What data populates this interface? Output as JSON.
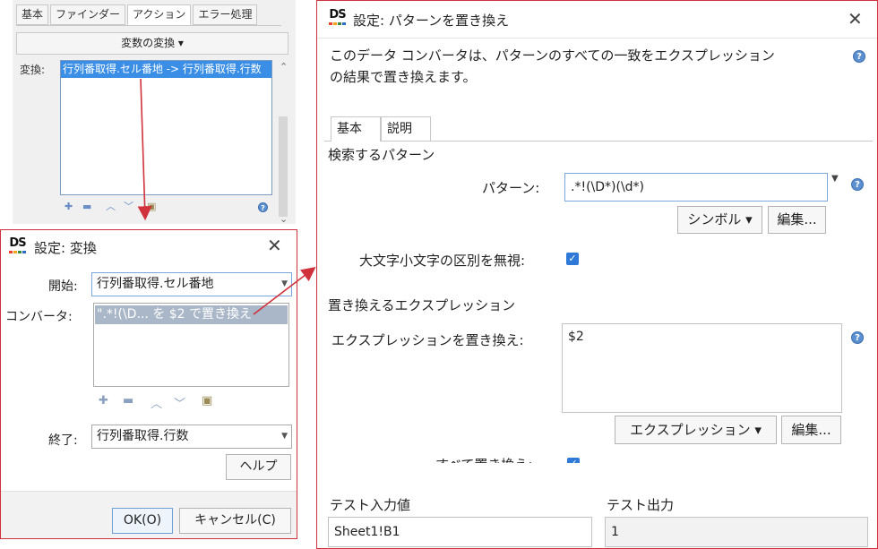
{
  "bg_panel": {
    "tabs": [
      "基本",
      "ファインダー",
      "アクション",
      "エラー処理"
    ],
    "active_tab": 2,
    "convert_menu": "変数の変換 ▾",
    "convert_label": "変換:",
    "convert_item": "行列番取得.セル番地 -> 行列番取得.行数"
  },
  "dialog1": {
    "title": "設定: 変換",
    "start_label": "開始:",
    "start_value": "行列番取得.セル番地",
    "converter_label": "コンバータ:",
    "converter_item": "\".*!(\\D... を $2 で置き換え",
    "end_label": "終了:",
    "end_value": "行列番取得.行数",
    "help_button": "ヘルプ",
    "ok_button": "OK(O)",
    "cancel_button": "キャンセル(C)"
  },
  "dialog2": {
    "title": "設定: パターンを置き換え",
    "description_line1": "このデータ コンバータは、パターンのすべての一致をエクスプレッション",
    "description_line2": "の結果で置き換えます。",
    "tabs": [
      "基本",
      "説明"
    ],
    "active_tab": 0,
    "search_section": "検索するパターン",
    "pattern_label": "パターン:",
    "pattern_value": ".*!(\\D*)(\\d*)",
    "symbol_button": "シンボル ▾",
    "edit_button": "編集...",
    "ignore_case_label": "大文字小文字の区別を無視:",
    "replace_section": "置き換えるエクスプレッション",
    "replace_label": "エクスプレッションを置き換え:",
    "replace_value": "$2",
    "expression_button": "エクスプレッション ▾",
    "edit_button2": "編集...",
    "replace_all_label": "すべて置き換え:",
    "test_input_label": "テスト入力値",
    "test_input_value": "Sheet1!B1",
    "test_output_label": "テスト出力",
    "test_output_value": "1"
  },
  "colors": {
    "accent_red": "#d0313a",
    "selection_blue": "#3a8ee6",
    "checkbox_blue": "#2f7ad8"
  }
}
